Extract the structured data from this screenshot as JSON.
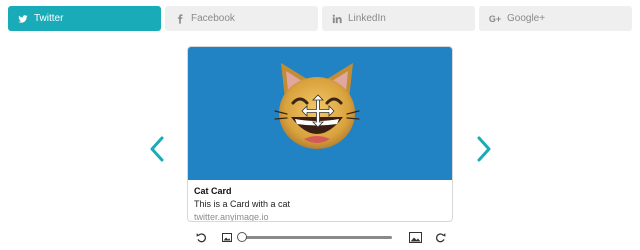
{
  "tabs": [
    {
      "label": "Twitter",
      "icon": "twitter-icon",
      "active": true
    },
    {
      "label": "Facebook",
      "icon": "facebook-icon",
      "active": false
    },
    {
      "label": "LinkedIn",
      "icon": "linkedin-icon",
      "active": false
    },
    {
      "label": "Google+",
      "icon": "google-plus-icon",
      "glyph": "G+",
      "active": false
    }
  ],
  "colors": {
    "accent": "#1aabb8",
    "card_image_bg": "#2283c4"
  },
  "nav": {
    "prev_icon": "chevron-left-icon",
    "next_icon": "chevron-right-icon"
  },
  "card": {
    "image_icon": "grinning-cat-emoji",
    "overlay_icon": "move-arrows-icon",
    "title": "Cat Card",
    "description": "This is a Card with a cat",
    "domain": "twitter.anyimage.io"
  },
  "zoom": {
    "level": 0.0
  }
}
